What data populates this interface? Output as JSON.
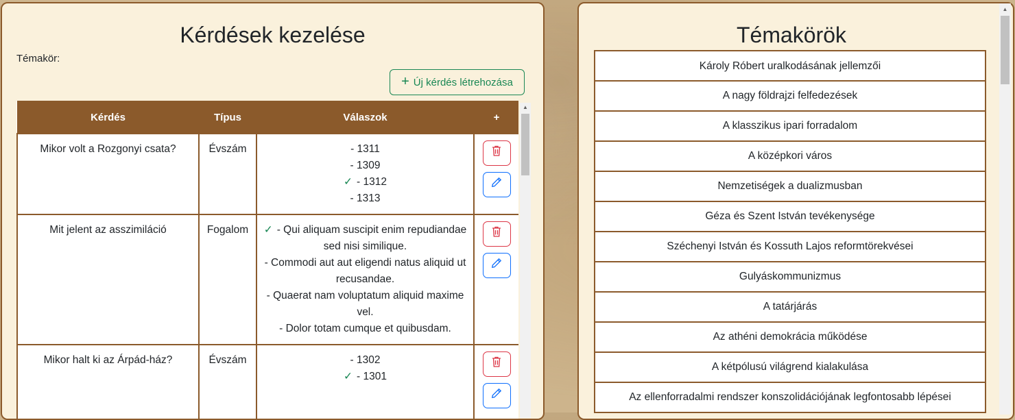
{
  "questions_panel": {
    "title": "Kérdések kezelése",
    "topic_label": "Témakör:",
    "new_question_label": "Új kérdés létrehozása",
    "table": {
      "headers": [
        "Kérdés",
        "Típus",
        "Válaszok",
        "+"
      ],
      "rows": [
        {
          "question": "Mikor volt a Rozgonyi csata?",
          "type": "Évszám",
          "answers": [
            {
              "text": "- 1311",
              "correct": false
            },
            {
              "text": "- 1309",
              "correct": false
            },
            {
              "text": "- 1312",
              "correct": true
            },
            {
              "text": "- 1313",
              "correct": false
            }
          ]
        },
        {
          "question": "Mit jelent az asszimiláció",
          "type": "Fogalom",
          "answers": [
            {
              "text": "- Qui aliquam suscipit enim repudiandae sed nisi similique.",
              "correct": true
            },
            {
              "text": "- Commodi aut aut eligendi natus aliquid ut recusandae.",
              "correct": false
            },
            {
              "text": "- Quaerat nam voluptatum aliquid maxime vel.",
              "correct": false
            },
            {
              "text": "- Dolor totam cumque et quibusdam.",
              "correct": false
            }
          ]
        },
        {
          "question": "Mikor halt ki az Árpád-ház?",
          "type": "Évszám",
          "answers": [
            {
              "text": "- 1302",
              "correct": false
            },
            {
              "text": "- 1301",
              "correct": true
            }
          ]
        }
      ]
    }
  },
  "topics_panel": {
    "title": "Témakörök",
    "topics": [
      "Károly Róbert uralkodásának jellemzői",
      "A nagy földrajzi felfedezések",
      "A klasszikus ipari forradalom",
      "A középkori város",
      "Nemzetiségek a dualizmusban",
      "Géza és Szent István tevékenysége",
      "Széchenyi István és Kossuth Lajos reformtörekvései",
      "Gulyáskommunizmus",
      "A tatárjárás",
      "Az athéni demokrácia működése",
      "A kétpólusú világrend kialakulása",
      "Az ellenforradalmi rendszer konszolidációjának legfontosabb lépései"
    ]
  },
  "icons": {
    "delete": "trash-icon",
    "edit": "pencil-icon",
    "correct": "check-icon",
    "add": "plus-icon"
  },
  "colors": {
    "header_brown": "#8b5a2b",
    "panel_bg": "#faf1dc",
    "success": "#198754",
    "danger": "#dc3545",
    "primary": "#0d6efd"
  }
}
